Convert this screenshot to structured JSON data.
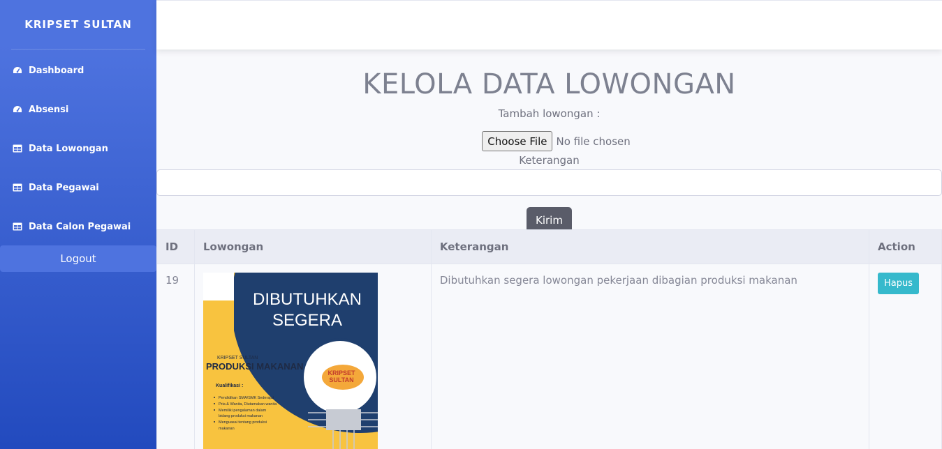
{
  "sidebar": {
    "brand": "KRIPSET SULTAN",
    "items": [
      {
        "label": "Dashboard",
        "icon": "gauge-icon"
      },
      {
        "label": "Absensi",
        "icon": "gauge-icon"
      },
      {
        "label": "Data Lowongan",
        "icon": "table-icon"
      },
      {
        "label": "Data Pegawai",
        "icon": "table-icon"
      },
      {
        "label": "Data Calon Pegawai",
        "icon": "table-icon"
      }
    ],
    "logout": "Logout"
  },
  "main": {
    "title": "KELOLA DATA LOWONGAN",
    "add_label": "Tambah lowongan :",
    "choose_file": "Choose File",
    "no_file": "No file chosen",
    "keterangan_label": "Keterangan",
    "keterangan_value": "",
    "submit": "Kirim"
  },
  "table": {
    "headers": [
      "ID",
      "Lowongan",
      "Keterangan",
      "Action"
    ],
    "rows": [
      {
        "id": "19",
        "keterangan": "Dibutuhkan segera lowongan pekerjaan dibagian produksi makanan",
        "action": "Hapus",
        "poster": {
          "headline1": "DIBUTUHKAN",
          "headline2": "SEGERA",
          "company": "KRIPSET SULTAN",
          "position": "PRODUKSI MAKANAN",
          "kualifikasi_title": "Kualifikasi :",
          "kualifikasi": [
            "Pendidikan SMA/SMK Sederajat",
            "Pria & Wanita, Diutamakan wanita",
            "Memiliki pengalaman dalam",
            "bidang produksi makanan",
            "Menguasai tentang produksi",
            "makanan"
          ],
          "logo_text1": "KRIPSET",
          "logo_text2": "SULTAN"
        }
      }
    ]
  },
  "colors": {
    "sidebar_top": "#4e73df",
    "sidebar_bottom": "#224abe",
    "submit_button": "#5a5c69",
    "delete_button": "#36b9cc",
    "poster_navy": "#1f3f6e",
    "poster_yellow": "#f8c33f"
  }
}
